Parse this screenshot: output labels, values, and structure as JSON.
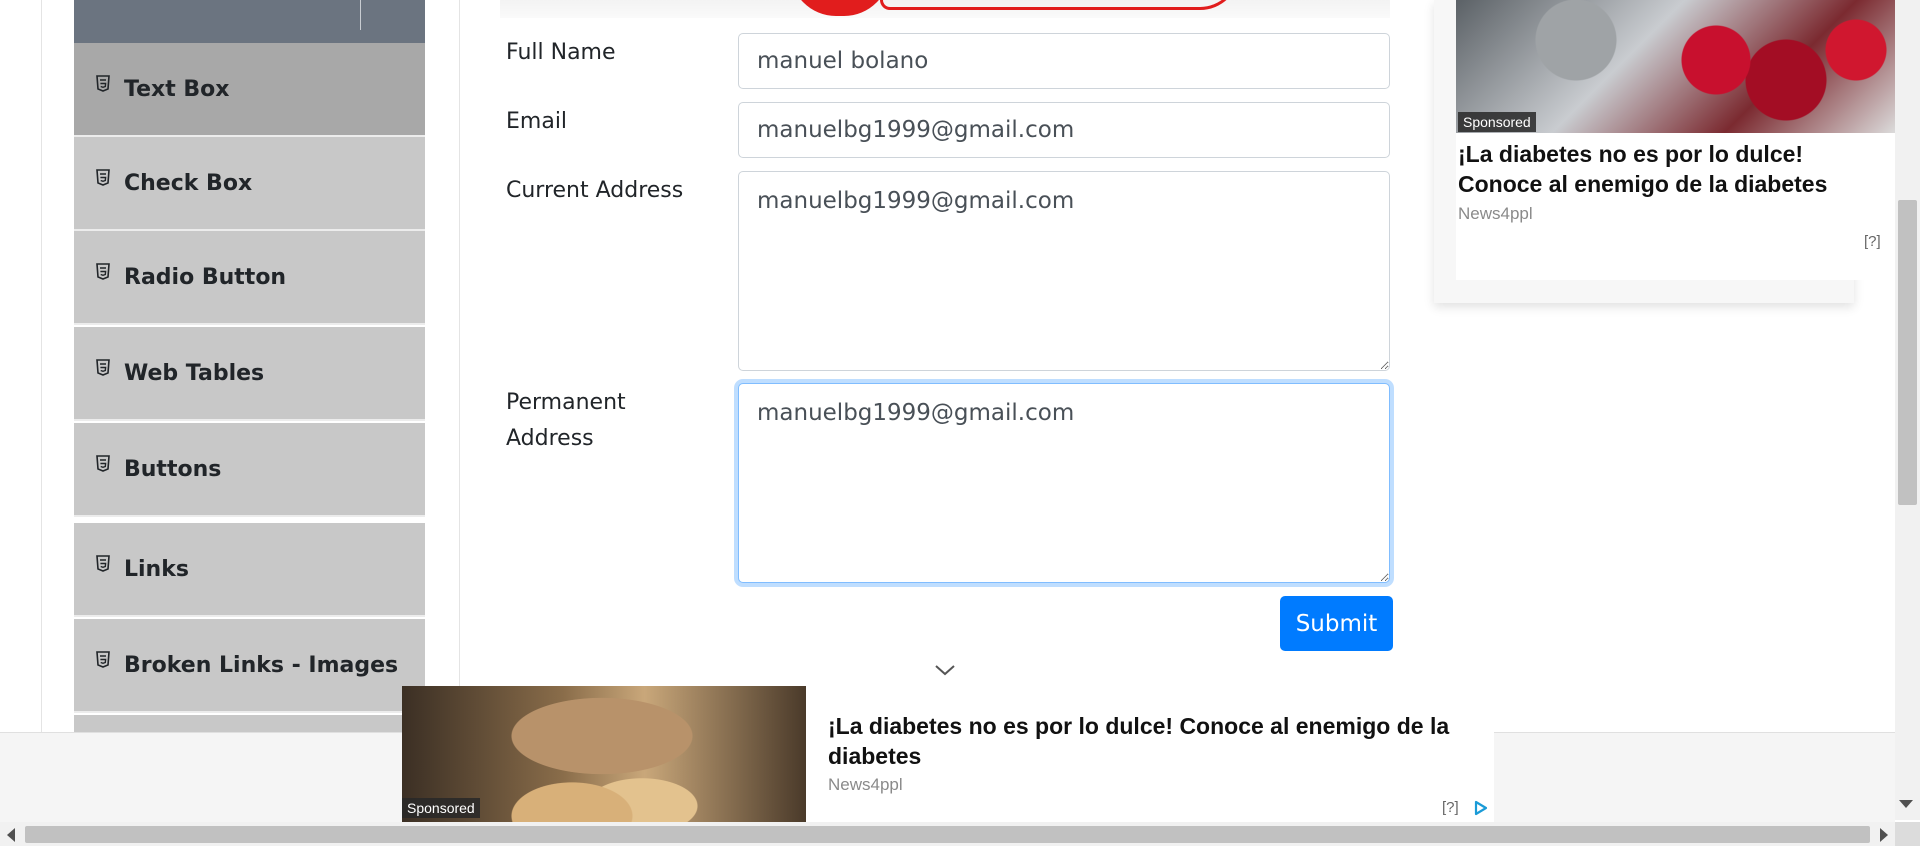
{
  "sidebar": {
    "items": [
      {
        "label": "Text Box",
        "active": true,
        "icon": "html5-icon"
      },
      {
        "label": "Check Box",
        "active": false,
        "icon": "html5-icon"
      },
      {
        "label": "Radio Button",
        "active": false,
        "icon": "html5-icon"
      },
      {
        "label": "Web Tables",
        "active": false,
        "icon": "html5-icon"
      },
      {
        "label": "Buttons",
        "active": false,
        "icon": "html5-icon"
      },
      {
        "label": "Links",
        "active": false,
        "icon": "html5-icon"
      },
      {
        "label": "Broken Links - Images",
        "active": false,
        "icon": "html5-icon"
      }
    ]
  },
  "form": {
    "full_name": {
      "label": "Full Name",
      "value": "manuel bolano"
    },
    "email": {
      "label": "Email",
      "value": "manuelbg1999@gmail.com"
    },
    "current_address": {
      "label": "Current Address",
      "value": "manuelbg1999@gmail.com"
    },
    "permanent_address": {
      "label_line1": "Permanent",
      "label_line2": "Address",
      "value": "manuelbg1999@gmail.com",
      "focused": true
    },
    "submit_label": "Submit"
  },
  "ads": {
    "right": {
      "sponsored": "Sponsored",
      "title_line1": "¡La diabetes no es por lo dulce!",
      "title_line2": "Conoce al enemigo de la diabetes",
      "source": "News4ppl",
      "help": "[?]"
    },
    "bottom": {
      "sponsored": "Sponsored",
      "title_line1": "¡La diabetes no es por lo dulce! Conoce al enemigo de la",
      "title_line2": "diabetes",
      "source": "News4ppl",
      "help": "[?]"
    }
  },
  "colors": {
    "primary": "#007bff",
    "sidebar_item": "#c8c8c8",
    "sidebar_item_active": "#a8a8a8",
    "focus_border": "#80bdff"
  }
}
